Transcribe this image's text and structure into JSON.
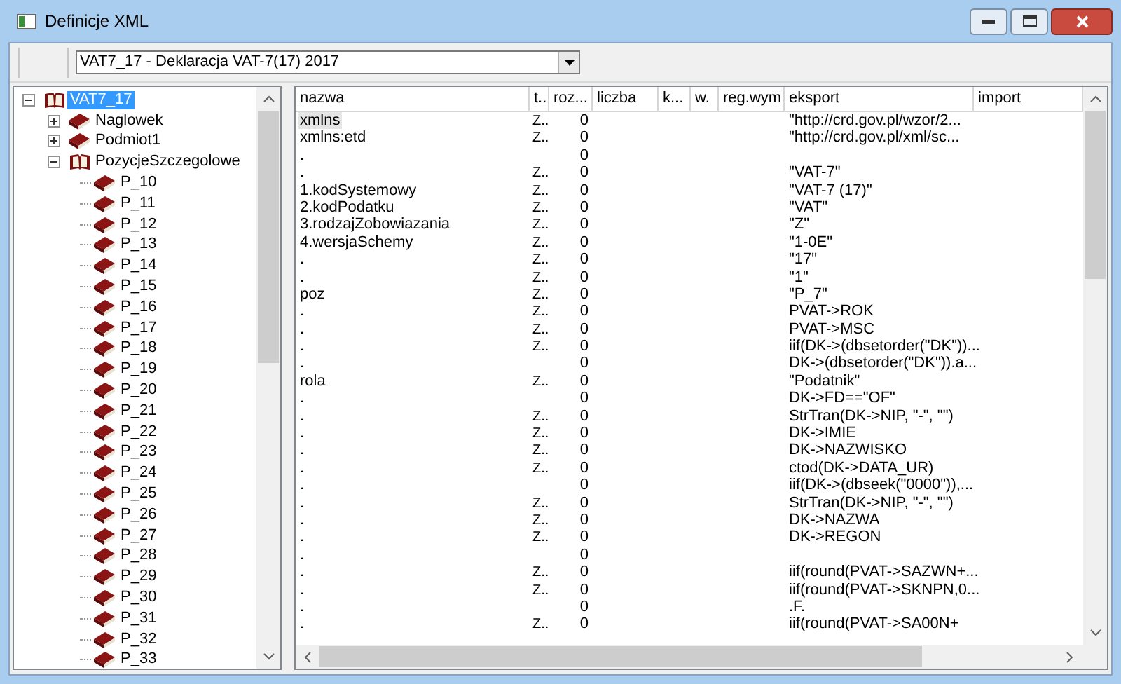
{
  "window": {
    "title": "Definicje XML"
  },
  "definition_combo": {
    "value": "VAT7_17 - Deklaracja VAT-7(17) 2017"
  },
  "tree": [
    {
      "label": "VAT7_17",
      "kind": "group",
      "expanded": true,
      "selected": true,
      "children": [
        {
          "label": "Naglowek",
          "kind": "group",
          "expanded": false,
          "selected": false
        },
        {
          "label": "Podmiot1",
          "kind": "group",
          "expanded": false,
          "selected": false
        },
        {
          "label": "PozycjeSzczegolowe",
          "kind": "group",
          "expanded": true,
          "selected": false,
          "children": [
            {
              "label": "P_10",
              "kind": "item",
              "selected": false
            },
            {
              "label": "P_11",
              "kind": "item",
              "selected": false
            },
            {
              "label": "P_12",
              "kind": "item",
              "selected": false
            },
            {
              "label": "P_13",
              "kind": "item",
              "selected": false
            },
            {
              "label": "P_14",
              "kind": "item",
              "selected": false
            },
            {
              "label": "P_15",
              "kind": "item",
              "selected": false
            },
            {
              "label": "P_16",
              "kind": "item",
              "selected": false
            },
            {
              "label": "P_17",
              "kind": "item",
              "selected": false
            },
            {
              "label": "P_18",
              "kind": "item",
              "selected": false
            },
            {
              "label": "P_19",
              "kind": "item",
              "selected": false
            },
            {
              "label": "P_20",
              "kind": "item",
              "selected": false
            },
            {
              "label": "P_21",
              "kind": "item",
              "selected": false
            },
            {
              "label": "P_22",
              "kind": "item",
              "selected": false
            },
            {
              "label": "P_23",
              "kind": "item",
              "selected": false
            },
            {
              "label": "P_24",
              "kind": "item",
              "selected": false
            },
            {
              "label": "P_25",
              "kind": "item",
              "selected": false
            },
            {
              "label": "P_26",
              "kind": "item",
              "selected": false
            },
            {
              "label": "P_27",
              "kind": "item",
              "selected": false
            },
            {
              "label": "P_28",
              "kind": "item",
              "selected": false
            },
            {
              "label": "P_29",
              "kind": "item",
              "selected": false
            },
            {
              "label": "P_30",
              "kind": "item",
              "selected": false
            },
            {
              "label": "P_31",
              "kind": "item",
              "selected": false
            },
            {
              "label": "P_32",
              "kind": "item",
              "selected": false
            },
            {
              "label": "P_33",
              "kind": "item",
              "selected": false
            }
          ]
        }
      ]
    }
  ],
  "table": {
    "columns": [
      "nazwa",
      "t..",
      "roz...",
      "liczba",
      "k...",
      "w.",
      "reg.wym.",
      "eksport",
      "import"
    ],
    "rows": [
      {
        "nazwa": "xmlns",
        "typ": "Z..",
        "roz": "0",
        "eksport": "\"http://crd.gov.pl/wzor/2...",
        "selected": true
      },
      {
        "nazwa": "xmlns:etd",
        "typ": "Z..",
        "roz": "0",
        "eksport": "\"http://crd.gov.pl/xml/sc...",
        "selected": false
      },
      {
        "nazwa": ".",
        "roz": "0",
        "selected": false
      },
      {
        "nazwa": ".",
        "typ": "Z..",
        "roz": "0",
        "eksport": "\"VAT-7\"",
        "selected": false
      },
      {
        "nazwa": "1.kodSystemowy",
        "typ": "Z..",
        "roz": "0",
        "eksport": "\"VAT-7 (17)\"",
        "selected": false
      },
      {
        "nazwa": "2.kodPodatku",
        "typ": "Z..",
        "roz": "0",
        "eksport": "\"VAT\"",
        "selected": false
      },
      {
        "nazwa": "3.rodzajZobowiazania",
        "typ": "Z..",
        "roz": "0",
        "eksport": "\"Z\"",
        "selected": false
      },
      {
        "nazwa": "4.wersjaSchemy",
        "typ": "Z..",
        "roz": "0",
        "eksport": "\"1-0E\"",
        "selected": false
      },
      {
        "nazwa": ".",
        "typ": "Z..",
        "roz": "0",
        "eksport": "\"17\"",
        "selected": false
      },
      {
        "nazwa": ".",
        "typ": "Z..",
        "roz": "0",
        "eksport": "\"1\"",
        "selected": false
      },
      {
        "nazwa": "poz",
        "typ": "Z..",
        "roz": "0",
        "eksport": "\"P_7\"",
        "selected": false
      },
      {
        "nazwa": ".",
        "typ": "Z..",
        "roz": "0",
        "eksport": "PVAT->ROK",
        "selected": false
      },
      {
        "nazwa": ".",
        "typ": "Z..",
        "roz": "0",
        "eksport": "PVAT->MSC",
        "selected": false
      },
      {
        "nazwa": ".",
        "typ": "Z..",
        "roz": "0",
        "eksport": "iif(DK->(dbsetorder(\"DK\"))...",
        "selected": false
      },
      {
        "nazwa": ".",
        "roz": "0",
        "eksport": "DK->(dbsetorder(\"DK\")).a...",
        "selected": false
      },
      {
        "nazwa": "rola",
        "typ": "Z..",
        "roz": "0",
        "eksport": "\"Podatnik\"",
        "selected": false
      },
      {
        "nazwa": ".",
        "roz": "0",
        "eksport": "DK->FD==\"OF\"",
        "selected": false
      },
      {
        "nazwa": ".",
        "typ": "Z..",
        "roz": "0",
        "eksport": "StrTran(DK->NIP,  \"-\", \"\")",
        "selected": false
      },
      {
        "nazwa": ".",
        "typ": "Z..",
        "roz": "0",
        "eksport": "DK->IMIE",
        "selected": false
      },
      {
        "nazwa": ".",
        "typ": "Z..",
        "roz": "0",
        "eksport": "DK->NAZWISKO",
        "selected": false
      },
      {
        "nazwa": ".",
        "typ": "Z..",
        "roz": "0",
        "eksport": "ctod(DK->DATA_UR)",
        "selected": false
      },
      {
        "nazwa": ".",
        "roz": "0",
        "eksport": "iif(DK->(dbseek(\"0000\")),...",
        "selected": false
      },
      {
        "nazwa": ".",
        "typ": "Z..",
        "roz": "0",
        "eksport": "StrTran(DK->NIP,  \"-\", \"\")",
        "selected": false
      },
      {
        "nazwa": ".",
        "typ": "Z..",
        "roz": "0",
        "eksport": "DK->NAZWA",
        "selected": false
      },
      {
        "nazwa": ".",
        "typ": "Z..",
        "roz": "0",
        "eksport": "DK->REGON",
        "selected": false
      },
      {
        "nazwa": ".",
        "roz": "0",
        "selected": false
      },
      {
        "nazwa": ".",
        "typ": "Z..",
        "roz": "0",
        "eksport": "iif(round(PVAT->SAZWN+...",
        "selected": false
      },
      {
        "nazwa": ".",
        "typ": "Z..",
        "roz": "0",
        "eksport": "iif(round(PVAT->SKNPN,0...",
        "selected": false
      },
      {
        "nazwa": ".",
        "roz": "0",
        "eksport": ".F.",
        "selected": false
      },
      {
        "nazwa": ".",
        "typ": "Z..",
        "roz": "0",
        "eksport": "iif(round(PVAT->SA00N+",
        "selected": false
      }
    ]
  }
}
